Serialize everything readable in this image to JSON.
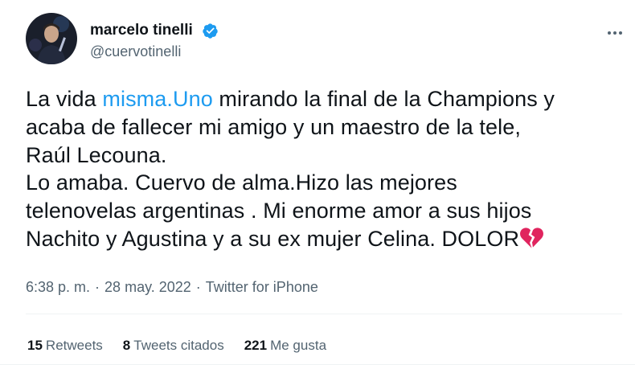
{
  "author": {
    "name": "marcelo tinelli",
    "handle": "@cuervotinelli",
    "verified": true
  },
  "tweet": {
    "lines": [
      {
        "before": "La vida ",
        "link": "misma.Uno",
        "after": " mirando la final de la Champions y"
      },
      {
        "text": "acaba de fallecer mi amigo y un maestro de la tele,"
      },
      {
        "text": "Raúl Lecouna."
      },
      {
        "text": "Lo amaba. Cuervo de alma.Hizo las mejores"
      },
      {
        "text": "telenovelas argentinas . Mi enorme amor a sus hijos"
      },
      {
        "text": "Nachito y Agustina y a su ex mujer Celina. DOLOR",
        "emoji": "broken-heart-icon"
      }
    ]
  },
  "meta": {
    "time": "6:38 p. m.",
    "separator": "·",
    "date": "28 may. 2022",
    "source": "Twitter for iPhone"
  },
  "stats": {
    "retweets_count": "15",
    "retweets_label": "Retweets",
    "quotes_count": "8",
    "quotes_label": "Tweets citados",
    "likes_count": "221",
    "likes_label": "Me gusta"
  },
  "colors": {
    "link": "#1d9bf0",
    "verified": "#1d9bf0",
    "secondary_text": "#536471",
    "primary_text": "#0f1419",
    "heart": "#e0245e"
  }
}
